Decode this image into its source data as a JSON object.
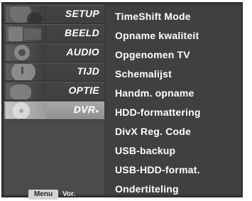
{
  "categories": [
    {
      "label": "SETUP",
      "icon": "setup-thumbnail-icon",
      "selected": false
    },
    {
      "label": "BEELD",
      "icon": "picture-thumbnail-icon",
      "selected": false
    },
    {
      "label": "AUDIO",
      "icon": "audio-thumbnail-icon",
      "selected": false
    },
    {
      "label": "TIJD",
      "icon": "clock-thumbnail-icon",
      "selected": false
    },
    {
      "label": "OPTIE",
      "icon": "option-thumbnail-icon",
      "selected": false
    },
    {
      "label": "DVR",
      "icon": "dvr-disc-thumbnail-icon",
      "selected": true
    }
  ],
  "arrow": "▸",
  "footer": {
    "menu_button": "Menu",
    "hint": "Vor."
  },
  "options": [
    "TimeShift Mode",
    "Opname kwaliteit",
    "Opgenomen TV",
    "Schemalijst",
    "Handm. opname",
    "HDD-formattering",
    "DivX Reg. Code",
    "USB-backup",
    "USB-HDD-format.",
    "Ondertiteling"
  ]
}
